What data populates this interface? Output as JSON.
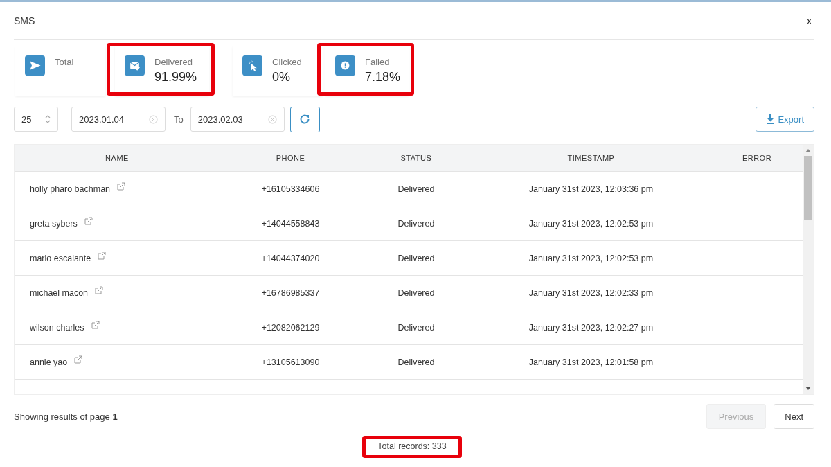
{
  "dialog": {
    "title": "SMS",
    "close": "x"
  },
  "stats": [
    {
      "kind": "send",
      "label": "Total",
      "highlighted": false
    },
    {
      "kind": "delivered",
      "label": "Delivered",
      "value": "91.99%",
      "highlighted": true
    },
    {
      "kind": "clicked",
      "label": "Clicked",
      "value": "0%",
      "highlighted": false
    },
    {
      "kind": "failed",
      "label": "Failed",
      "value": "7.18%",
      "highlighted": true
    }
  ],
  "filters": {
    "page_size": "25",
    "from": "2023.01.04",
    "to_label": "To",
    "to": "2023.02.03",
    "export": "Export"
  },
  "table": {
    "columns": [
      "NAME",
      "PHONE",
      "STATUS",
      "TIMESTAMP",
      "ERROR"
    ],
    "rows": [
      {
        "name": "holly pharo bachman",
        "phone": "+16105334606",
        "status": "Delivered",
        "timestamp": "January 31st 2023, 12:03:36 pm"
      },
      {
        "name": "greta sybers",
        "phone": "+14044558843",
        "status": "Delivered",
        "timestamp": "January 31st 2023, 12:02:53 pm"
      },
      {
        "name": "mario escalante",
        "phone": "+14044374020",
        "status": "Delivered",
        "timestamp": "January 31st 2023, 12:02:53 pm"
      },
      {
        "name": "michael macon",
        "phone": "+16786985337",
        "status": "Delivered",
        "timestamp": "January 31st 2023, 12:02:33 pm"
      },
      {
        "name": "wilson charles",
        "phone": "+12082062129",
        "status": "Delivered",
        "timestamp": "January 31st 2023, 12:02:27 pm"
      },
      {
        "name": "annie yao",
        "phone": "+13105613090",
        "status": "Delivered",
        "timestamp": "January 31st 2023, 12:01:58 pm"
      }
    ]
  },
  "footer": {
    "showing": "Showing results of page **1**",
    "previous": {
      "label": "Previous",
      "disabled": true
    },
    "next": {
      "label": "Next",
      "disabled": false
    },
    "total": "Total records: 333",
    "total_highlighted": true
  }
}
